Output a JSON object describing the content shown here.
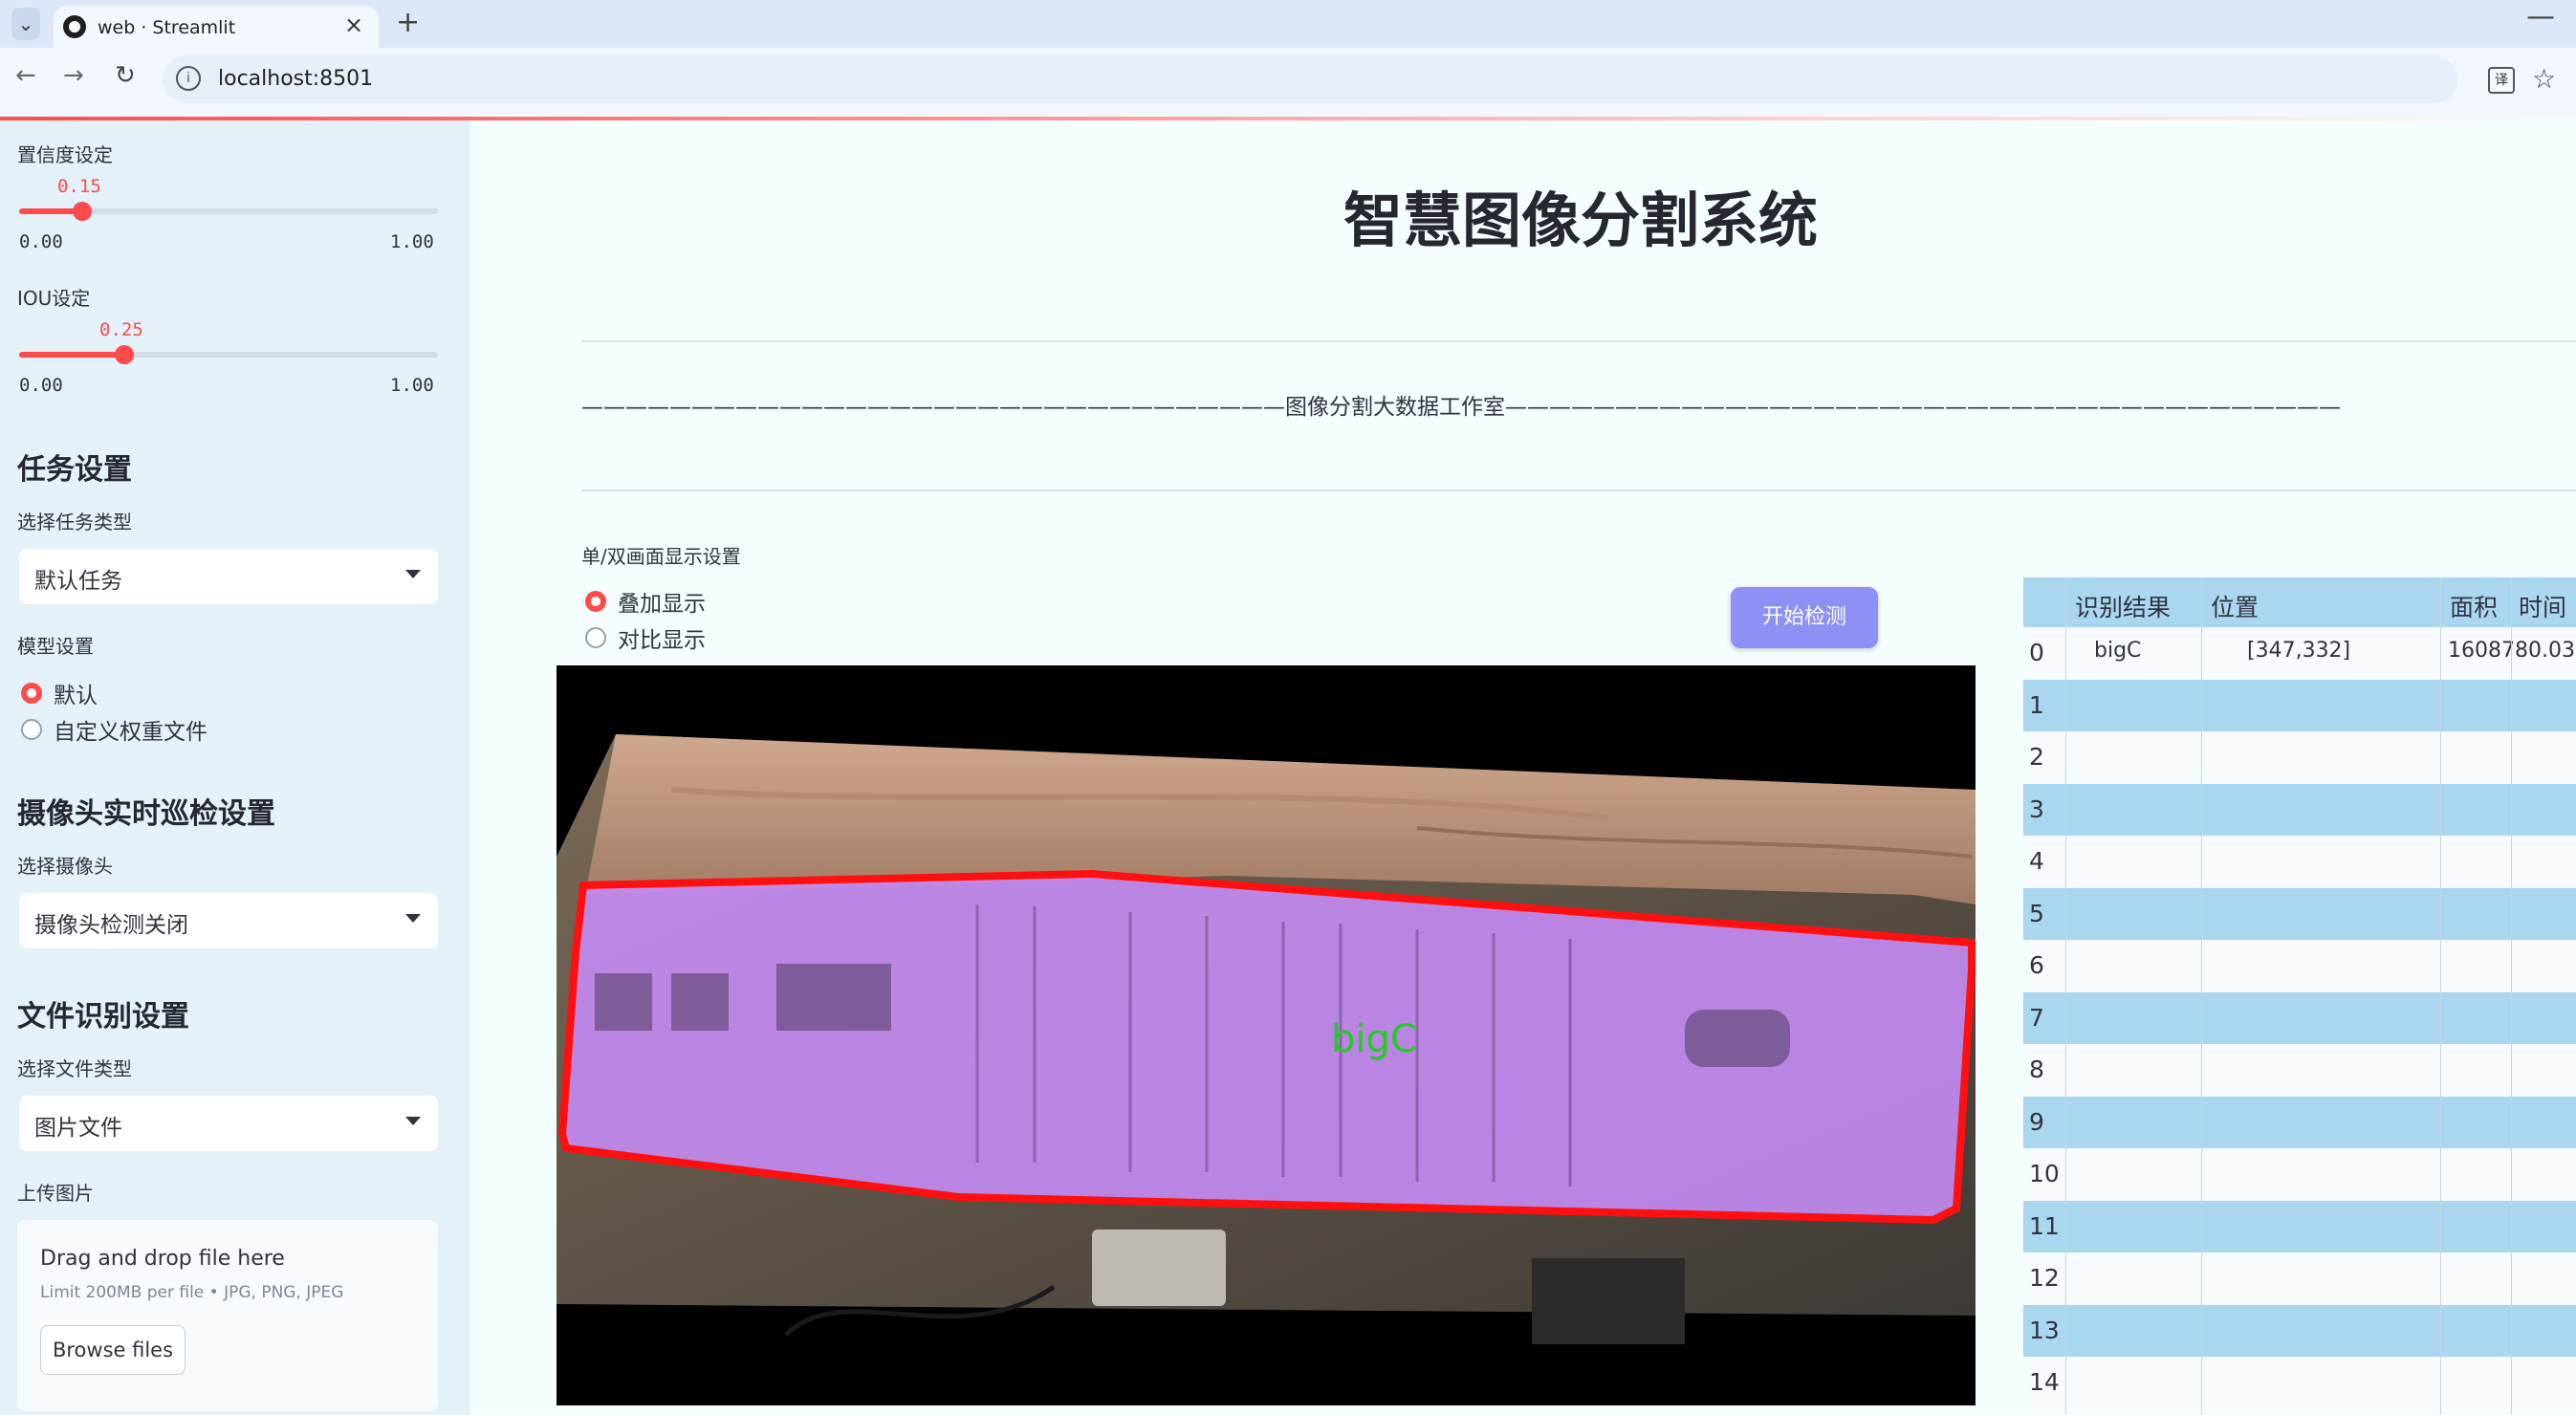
{
  "browser": {
    "tab_title": "web · Streamlit",
    "tab_close": "×",
    "new_tab": "+",
    "minimize": "—",
    "url": "localhost:8501",
    "back": "←",
    "forward": "→",
    "reload": "↻",
    "star": "☆",
    "translate": "译"
  },
  "sidebar": {
    "confidence": {
      "label": "置信度设定",
      "value": "0.15",
      "value_fraction": 0.15,
      "min": "0.00",
      "max": "1.00"
    },
    "iou": {
      "label": "IOU设定",
      "value": "0.25",
      "value_fraction": 0.25,
      "min": "0.00",
      "max": "1.00"
    },
    "task_header": "任务设置",
    "task_type_label": "选择任务类型",
    "task_type_value": "默认任务",
    "model_label": "模型设置",
    "model_options": [
      "默认",
      "自定义权重文件"
    ],
    "model_selected": 0,
    "camera_header": "摄像头实时巡检设置",
    "camera_label": "选择摄像头",
    "camera_value": "摄像头检测关闭",
    "file_header": "文件识别设置",
    "file_type_label": "选择文件类型",
    "file_type_value": "图片文件",
    "upload_label": "上传图片",
    "upload_drop": "Drag and drop file here",
    "upload_limit": "Limit 200MB per file • JPG, PNG, JPEG",
    "upload_button": "Browse files"
  },
  "main": {
    "title": "智慧图像分割系统",
    "subtitle": "————————————————————————————————图像分割大数据工作室——————————————————————————————————————",
    "display_label": "单/双画面显示设置",
    "display_options": [
      "叠加显示",
      "对比显示"
    ],
    "display_selected": 0,
    "start_button": "开始检测",
    "detection_label": "bigC"
  },
  "table": {
    "headers": [
      "识别结果",
      "位置",
      "面积",
      "时间"
    ],
    "rows": [
      {
        "index": "0",
        "result": "bigC",
        "position": "[347,332]",
        "area": "1608780.03",
        "time": ""
      },
      {
        "index": "1"
      },
      {
        "index": "2"
      },
      {
        "index": "3"
      },
      {
        "index": "4"
      },
      {
        "index": "5"
      },
      {
        "index": "6"
      },
      {
        "index": "7"
      },
      {
        "index": "8"
      },
      {
        "index": "9"
      },
      {
        "index": "10"
      },
      {
        "index": "11"
      },
      {
        "index": "12"
      },
      {
        "index": "13"
      },
      {
        "index": "14"
      }
    ]
  },
  "colors": {
    "accent": "#ff4b4b",
    "button": "#8d91f5",
    "table_header": "#a9d7ef",
    "sidebar_bg": "#e4f1f9",
    "detection_text": "#22cc22",
    "mask_fill": "#c28af0",
    "mask_outline": "#ff1010"
  }
}
